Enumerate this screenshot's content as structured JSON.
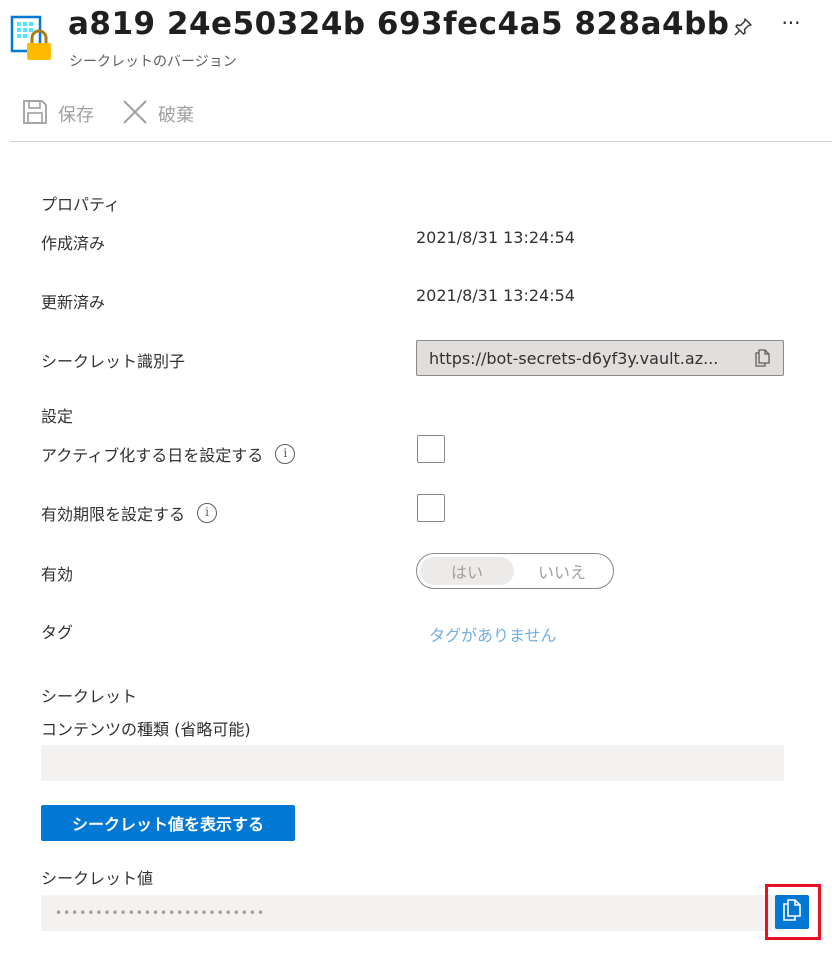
{
  "header": {
    "title": "a819  24e50324b  693fec4a5  828a4bb",
    "subtitle": "シークレットのバージョン",
    "pin_icon": "pin-icon",
    "more_label": "···"
  },
  "toolbar": {
    "save_label": "保存",
    "discard_label": "破棄"
  },
  "properties": {
    "section_title": "プロパティ",
    "created_label": "作成済み",
    "created_value": "2021/8/31 13:24:54",
    "updated_label": "更新済み",
    "updated_value": "2021/8/31 13:24:54",
    "identifier_label": "シークレット識別子",
    "identifier_value": "https://bot-secrets-d6yf3y.vault.az..."
  },
  "settings": {
    "section_title": "設定",
    "activation_label": "アクティブ化する日を設定する",
    "activation_checked": false,
    "expiration_label": "有効期限を設定する",
    "expiration_checked": false,
    "enabled_label": "有効",
    "enabled_yes": "はい",
    "enabled_no": "いいえ",
    "enabled_selected": "はい",
    "tags_label": "タグ",
    "tags_value": "タグがありません"
  },
  "secret": {
    "section_title": "シークレット",
    "content_type_label": "コンテンツの種類 (省略可能)",
    "content_type_value": "",
    "show_button_label": "シークレット値を表示する",
    "value_label": "シークレット値",
    "masked_value": "••••••••••••••••••••••••••"
  },
  "colors": {
    "accent": "#0078d4",
    "highlight": "#e81123",
    "link": "#71afe5"
  }
}
